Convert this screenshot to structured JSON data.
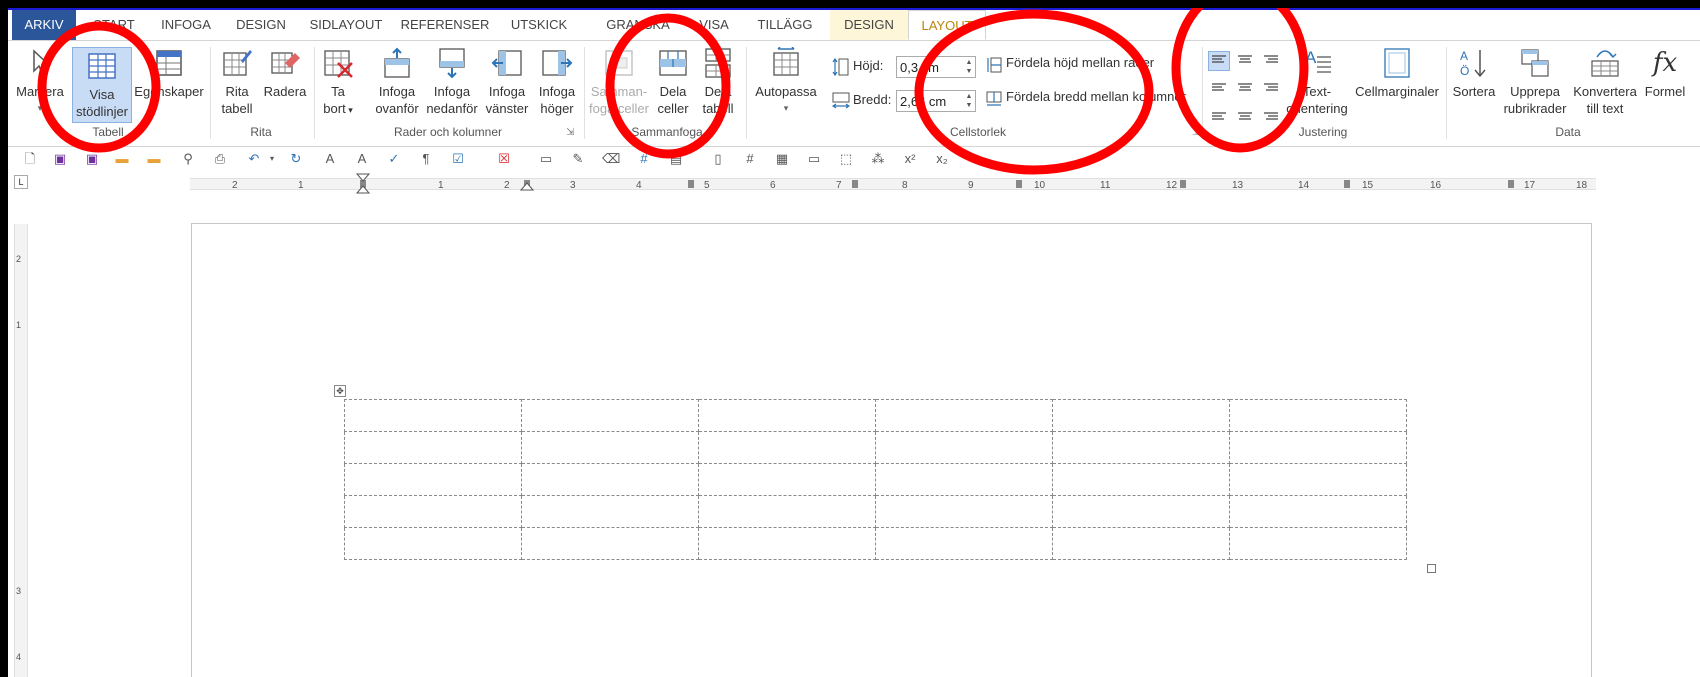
{
  "tabs": {
    "file": "ARKIV",
    "items": [
      "START",
      "INFOGA",
      "DESIGN",
      "SIDLAYOUT",
      "REFERENSER",
      "UTSKICK",
      "GRANSKA",
      "VISA",
      "TILLÄGG"
    ],
    "context_design": "DESIGN",
    "context_layout": "LAYOUT"
  },
  "ribbon": {
    "tabell": {
      "group": "Tabell",
      "markera": "Markera",
      "visa_l1": "Visa",
      "visa_l2": "stödlinjer",
      "egenskaper": "Egenskaper"
    },
    "rita": {
      "group": "Rita",
      "rita_l1": "Rita",
      "rita_l2": "tabell",
      "radera": "Radera"
    },
    "rader": {
      "group": "Rader och kolumner",
      "tabort_l1": "Ta",
      "tabort_l2": "bort",
      "ovan_l1": "Infoga",
      "ovan_l2": "ovanför",
      "ned_l1": "Infoga",
      "ned_l2": "nedanför",
      "vanster_l1": "Infoga",
      "vanster_l2": "vänster",
      "hoger_l1": "Infoga",
      "hoger_l2": "höger"
    },
    "sammanfoga": {
      "group": "Sammanfoga",
      "samman_l1": "Samman-",
      "samman_l2": "foga celler",
      "delaceller_l1": "Dela",
      "delaceller_l2": "celler",
      "delatabell_l1": "Dela",
      "delatabell_l2": "tabell"
    },
    "cellstorlek": {
      "group": "Cellstorlek",
      "autopassa": "Autopassa",
      "hojd_label": "Höjd:",
      "hojd_value": "0,3 cm",
      "bredd_label": "Bredd:",
      "bredd_value": "2,66 cm",
      "fordela_rader": "Fördela höjd mellan rader",
      "fordela_kolumner": "Fördela bredd mellan kolumner"
    },
    "justering": {
      "group": "Justering",
      "text_l1": "Text-",
      "text_l2": "orientering",
      "cellmarginaler": "Cellmarginaler"
    },
    "data": {
      "group": "Data",
      "sortera": "Sortera",
      "upprepa_l1": "Upprepa",
      "upprepa_l2": "rubrikrader",
      "konvertera_l1": "Konvertera",
      "konvertera_l2": "till text",
      "formel": "Formel",
      "formel_icon_text": "fx"
    }
  },
  "ruler": {
    "numbers": [
      "2",
      "1",
      "1",
      "2",
      "3",
      "4",
      "5",
      "6",
      "7",
      "8",
      "9",
      "10",
      "11",
      "12",
      "13",
      "14",
      "15",
      "16",
      "17",
      "18"
    ],
    "corner": "L",
    "vertical": [
      "2",
      "1",
      "3",
      "4"
    ]
  },
  "table": {
    "rows": 5,
    "cols": 6
  },
  "colors": {
    "file_tab": "#2b579a",
    "context_tab": "#fdf6d8",
    "active_tab_text": "#b8860b",
    "selection": "#c9dcf5",
    "annotation": "#ff0000",
    "frame_border": "#1b1bd6"
  }
}
